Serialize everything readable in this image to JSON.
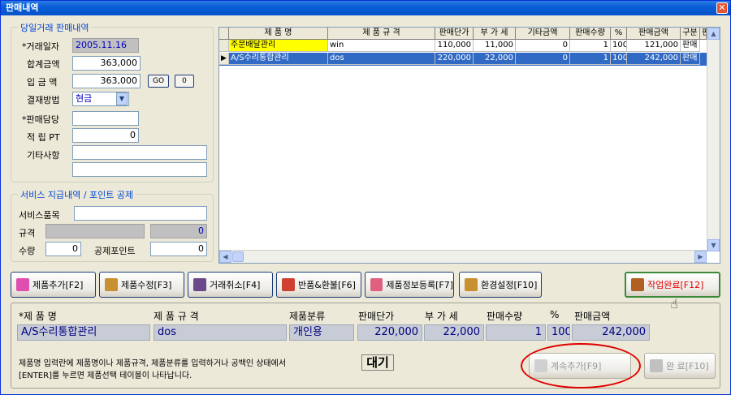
{
  "window": {
    "title": "판매내역"
  },
  "sale_group": {
    "legend": "당일거래 판매내역",
    "date_label": "*거래일자",
    "date_value": "2005.11.16",
    "total_label": "합계금액",
    "total_value": "363,000",
    "deposit_label": "입 금 액",
    "deposit_value": "363,000",
    "go_label": "GO",
    "zero_label": "0",
    "payment_label": "결재방법",
    "payment_value": "현금",
    "staff_label": "*판매담당",
    "staff_value": "",
    "points_label": "적 립 PT",
    "points_value": "0",
    "etc_label": "기타사항",
    "etc_value1": "",
    "etc_value2": ""
  },
  "service_group": {
    "legend": "서비스 지급내역 / 포인트 공제",
    "item_label": "서비스품목",
    "item_value": "",
    "spec_label": "규격",
    "spec_value": "",
    "spec_num": "0",
    "qty_label": "수량",
    "qty_value": "0",
    "deduct_label": "공제포인트",
    "deduct_value": "0"
  },
  "grid": {
    "columns": [
      "제 품 명",
      "제 품 규 격",
      "판매단가",
      "부 가 세",
      "기타금액",
      "판매수량",
      "%",
      "판매금액",
      "구분",
      "판"
    ],
    "rows": [
      {
        "name": "주문배달관리",
        "spec": "win",
        "price": "110,000",
        "vat": "11,000",
        "etc": "0",
        "qty": "1",
        "pct": "100",
        "amount": "121,000",
        "kind": "판매"
      },
      {
        "name": "A/S수리통합관리",
        "spec": "dos",
        "price": "220,000",
        "vat": "22,000",
        "etc": "0",
        "qty": "1",
        "pct": "100",
        "amount": "242,000",
        "kind": "판매"
      }
    ]
  },
  "toolbar": {
    "add": "제품추가[F2]",
    "edit": "제품수정[F3]",
    "cancel": "거래취소[F4]",
    "refund": "반품&환불[F6]",
    "register": "제품정보등록[F7]",
    "settings": "환경설정[F10]",
    "done": "작업완료[F12]"
  },
  "detail": {
    "h_name": "*제 품 명",
    "h_spec": "제 품 규 격",
    "h_cat": "제품분류",
    "h_price": "판매단가",
    "h_vat": "부 가 세",
    "h_qty": "판매수량",
    "h_pct": "%",
    "h_amount": "판매금액",
    "name": "A/S수리통합관리",
    "spec": "dos",
    "cat": "개인용",
    "price": "220,000",
    "vat": "22,000",
    "qty": "1",
    "pct": "100",
    "amount": "242,000",
    "help_line1": "제품명 입력란에 제품명이나 제품규격, 제품분류를 입력하거나 공백인 상태에서",
    "help_line2": "[ENTER]를 누르면 제품선택 테이블이 나타납니다.",
    "status": "대기",
    "continue_btn": "계속추가[F9]",
    "finish_btn": "완 료[F10]"
  },
  "colors": {
    "accent_red": "#e00000",
    "selection": "#316ac5",
    "highlight": "#ffff00"
  }
}
